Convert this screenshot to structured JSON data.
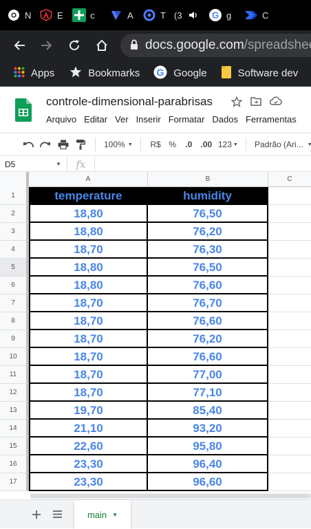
{
  "browser": {
    "tabs": [
      {
        "icon": "chrome-icon",
        "title": "N"
      },
      {
        "icon": "angular-icon",
        "title": "E"
      },
      {
        "icon": "sheets-plus-icon",
        "title": "c"
      },
      {
        "icon": "relay-icon",
        "title": "A"
      },
      {
        "icon": "circle-icon",
        "title": "T"
      },
      {
        "icon": "speaker-icon",
        "title": "(3"
      },
      {
        "icon": "google-icon",
        "title": "g"
      },
      {
        "icon": "power-automate-icon",
        "title": "C"
      }
    ],
    "url_host": "docs.google.com",
    "url_path": "/spreadsheets",
    "bookmarks": [
      {
        "icon": "apps-grid-icon",
        "label": "Apps"
      },
      {
        "icon": "star-icon",
        "label": "Bookmarks"
      },
      {
        "icon": "google-icon",
        "label": "Google"
      },
      {
        "icon": "folder-icon",
        "label": "Software dev"
      }
    ]
  },
  "doc": {
    "title": "controle-dimensional-parabrisas",
    "menu": [
      "Arquivo",
      "Editar",
      "Ver",
      "Inserir",
      "Formatar",
      "Dados",
      "Ferramentas"
    ]
  },
  "toolbar": {
    "zoom": "100%",
    "currency": "R$",
    "percent": "%",
    "dec_less": ".0",
    "dec_more": ".00",
    "format": "123",
    "font": "Padrão (Ari..."
  },
  "formula": {
    "cell_ref": "D5",
    "fx": "fx",
    "value": ""
  },
  "grid": {
    "columns": [
      "A",
      "B",
      "C"
    ],
    "rows": [
      {
        "num": "1",
        "a": "temperature",
        "b": "humidity"
      },
      {
        "num": "2",
        "a": "18,80",
        "b": "76,50"
      },
      {
        "num": "3",
        "a": "18,80",
        "b": "76,20"
      },
      {
        "num": "4",
        "a": "18,70",
        "b": "76,30"
      },
      {
        "num": "5",
        "a": "18,80",
        "b": "76,50"
      },
      {
        "num": "6",
        "a": "18,80",
        "b": "76,60"
      },
      {
        "num": "7",
        "a": "18,70",
        "b": "76,70"
      },
      {
        "num": "8",
        "a": "18,70",
        "b": "76,60"
      },
      {
        "num": "9",
        "a": "18,70",
        "b": "76,20"
      },
      {
        "num": "10",
        "a": "18,70",
        "b": "76,60"
      },
      {
        "num": "11",
        "a": "18,70",
        "b": "77,00"
      },
      {
        "num": "12",
        "a": "18,70",
        "b": "77,10"
      },
      {
        "num": "13",
        "a": "19,70",
        "b": "85,40"
      },
      {
        "num": "14",
        "a": "21,10",
        "b": "93,20"
      },
      {
        "num": "15",
        "a": "22,60",
        "b": "95,80"
      },
      {
        "num": "16",
        "a": "23,30",
        "b": "96,40"
      },
      {
        "num": "17",
        "a": "23,30",
        "b": "96,60"
      }
    ]
  },
  "sheets": {
    "active_tab": "main"
  },
  "colors": {
    "cell_text": "#4a86e8",
    "header_bg": "#000000",
    "sheets_green": "#188038",
    "chrome_bg": "#202124"
  }
}
